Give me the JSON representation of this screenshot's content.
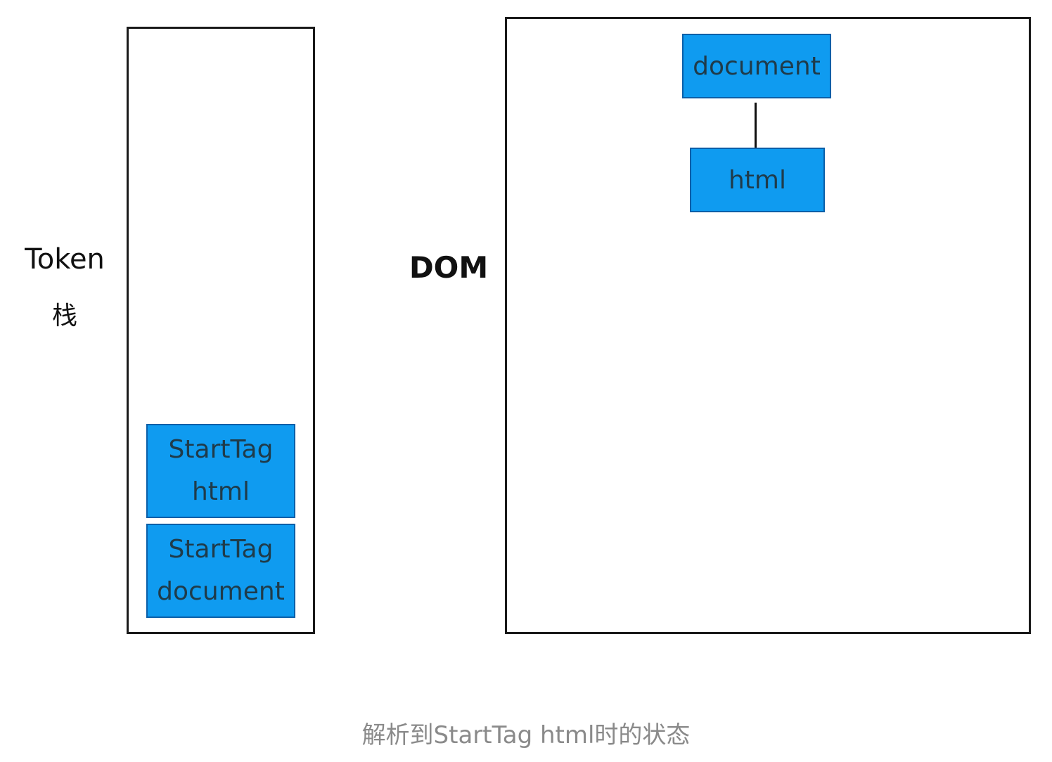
{
  "token_stack": {
    "label": "Token",
    "label_suffix": "栈",
    "items": [
      {
        "line1": "StartTag",
        "line2": "html"
      },
      {
        "line1": "StartTag",
        "line2": "document"
      }
    ]
  },
  "dom": {
    "label": "DOM",
    "nodes": {
      "root": "document",
      "child": "html"
    }
  },
  "caption": "解析到StartTag html时的状态",
  "colors": {
    "box_fill": "#0f9bf0",
    "box_border": "#0b5fa8",
    "box_text": "#1f3b4a",
    "frame": "#1a1a1a",
    "caption": "#8a8a8a"
  }
}
